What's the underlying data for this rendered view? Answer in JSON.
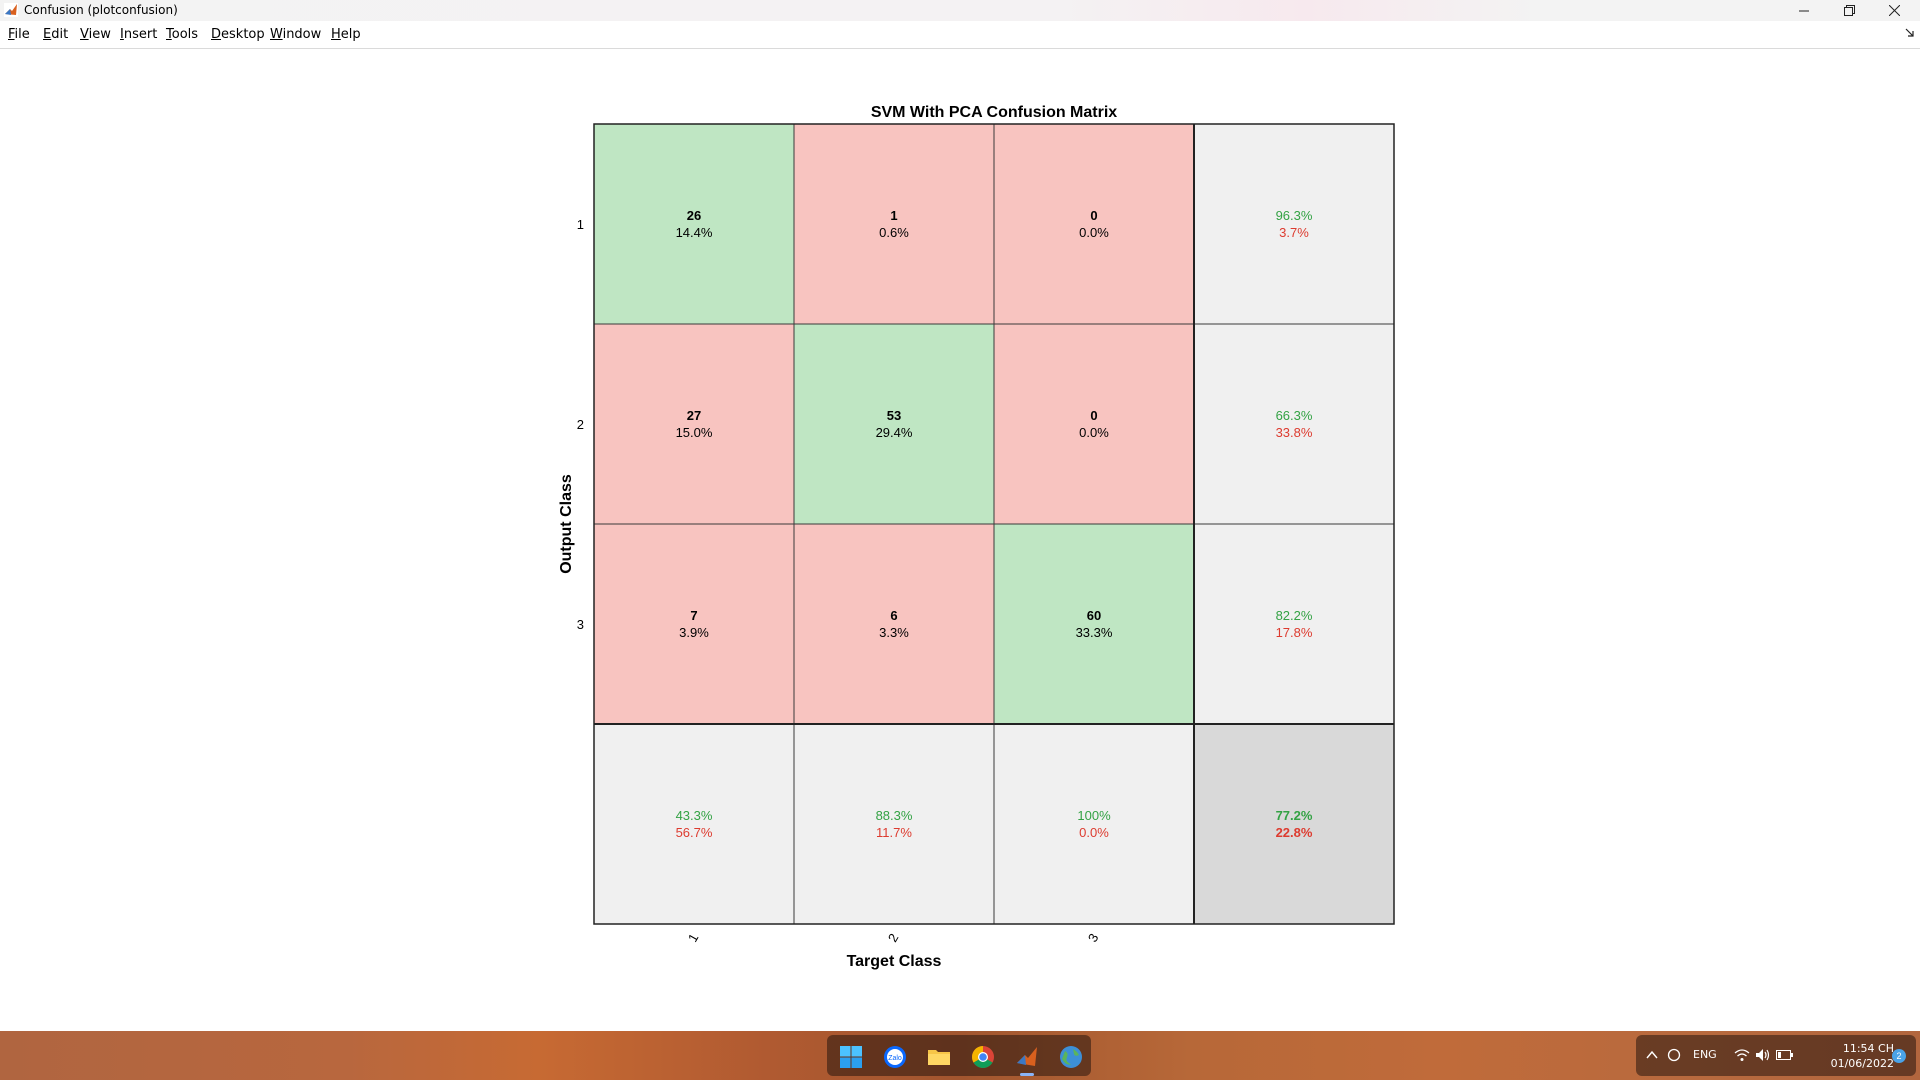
{
  "window": {
    "title": "Confusion (plotconfusion)",
    "minimize_icon": "minimize-icon",
    "maximize_icon": "restore-icon",
    "close_icon": "close-icon"
  },
  "menu": {
    "items": [
      "File",
      "Edit",
      "View",
      "Insert",
      "Tools",
      "Desktop",
      "Window",
      "Help"
    ]
  },
  "chart_data": {
    "type": "table",
    "title": "SVM With PCA  Confusion Matrix",
    "xlabel": "Target Class",
    "ylabel": "Output Class",
    "x_tick_labels": [
      "1",
      "2",
      "3"
    ],
    "y_tick_labels": [
      "1",
      "2",
      "3"
    ],
    "matrix": [
      [
        {
          "count": "26",
          "pct": "14.4%"
        },
        {
          "count": "1",
          "pct": "0.6%"
        },
        {
          "count": "0",
          "pct": "0.0%"
        }
      ],
      [
        {
          "count": "27",
          "pct": "15.0%"
        },
        {
          "count": "53",
          "pct": "29.4%"
        },
        {
          "count": "0",
          "pct": "0.0%"
        }
      ],
      [
        {
          "count": "7",
          "pct": "3.9%"
        },
        {
          "count": "6",
          "pct": "3.3%"
        },
        {
          "count": "60",
          "pct": "33.3%"
        }
      ]
    ],
    "row_summary": [
      {
        "correct": "96.3%",
        "wrong": "3.7%"
      },
      {
        "correct": "66.3%",
        "wrong": "33.8%"
      },
      {
        "correct": "82.2%",
        "wrong": "17.8%"
      }
    ],
    "col_summary": [
      {
        "correct": "43.3%",
        "wrong": "56.7%"
      },
      {
        "correct": "88.3%",
        "wrong": "11.7%"
      },
      {
        "correct": "100%",
        "wrong": "0.0%"
      }
    ],
    "overall": {
      "correct": "77.2%",
      "wrong": "22.8%"
    },
    "colors": {
      "correct_cell": "#bfe6c3",
      "wrong_cell": "#f8c4c0",
      "summary_cell": "#f0f0f0",
      "overall_cell": "#d9d9d9",
      "correct_text": "#33a244",
      "wrong_text": "#dd3b2f"
    }
  },
  "taskbar": {
    "apps": [
      "windows-start-icon",
      "zalo-icon",
      "file-explorer-icon",
      "chrome-icon",
      "matlab-icon",
      "earth-app-icon"
    ],
    "tray": {
      "language": "ENG",
      "time": "11:54 CH",
      "date": "01/06/2022",
      "notifications": "2"
    }
  }
}
